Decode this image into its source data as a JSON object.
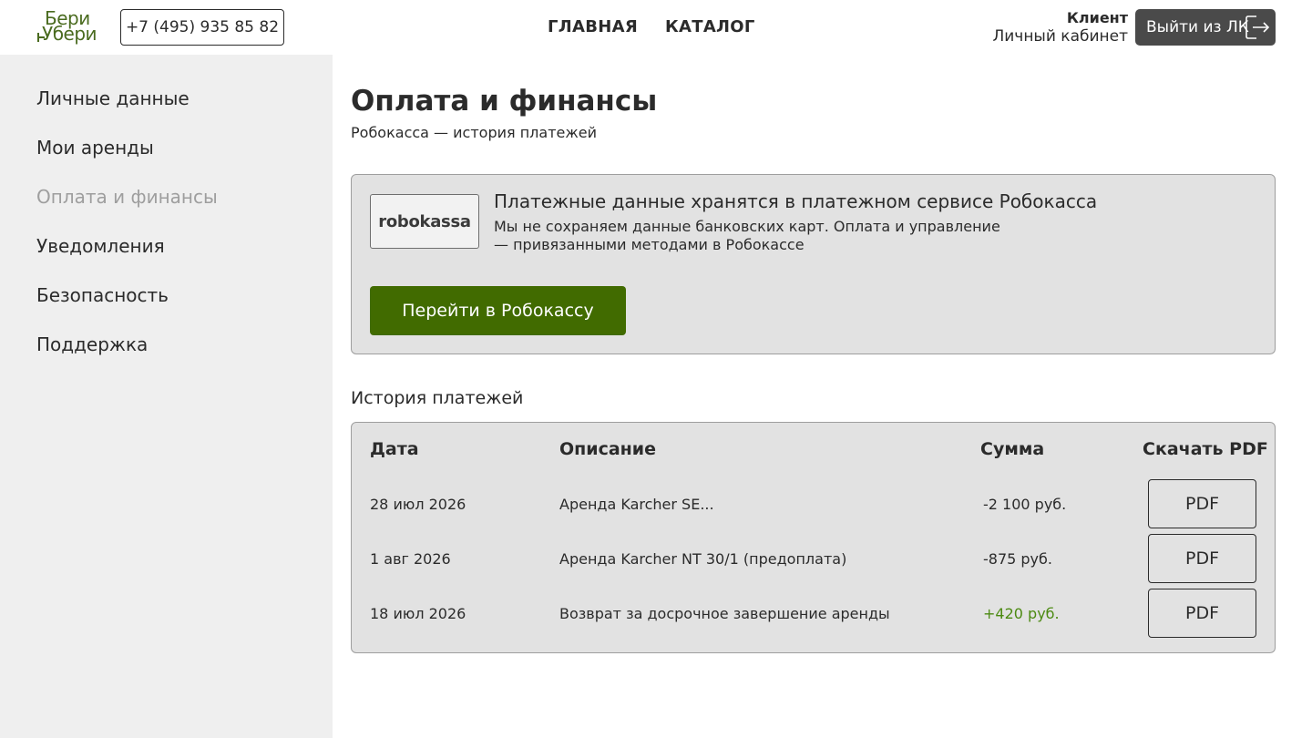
{
  "header": {
    "logo_line1": "Бери",
    "logo_line2": "Убери",
    "phone": "+7 (495) 935 85 82",
    "nav": [
      {
        "label": "ГЛАВНАЯ"
      },
      {
        "label": "КАТАЛОГ"
      }
    ],
    "user_role": "Клиент",
    "user_area": "Личный кабинет",
    "logout_label": "Выйти из ЛК",
    "logout_icon": "logout-icon"
  },
  "sidebar": {
    "items": [
      {
        "label": "Личные данные",
        "active": false
      },
      {
        "label": "Мои аренды",
        "active": false
      },
      {
        "label": "Оплата и финансы",
        "active": true
      },
      {
        "label": "Уведомления",
        "active": false
      },
      {
        "label": "Безопасность",
        "active": false
      },
      {
        "label": "Поддержка",
        "active": false
      }
    ]
  },
  "main": {
    "title": "Оплата и финансы",
    "subtitle": "Робокасса — история платежей",
    "robokassa": {
      "logo_text": "robokassa",
      "title": "Платежные данные хранятся в платежном сервисе Робокасса",
      "description": "Мы не сохраняем данные банковских карт. Оплата и управление — привязанными методами в Робокассе",
      "button_label": "Перейти в Робокассу"
    },
    "history": {
      "title": "История платежей",
      "columns": {
        "date": "Дата",
        "description": "Описание",
        "amount": "Сумма",
        "pdf": "Скачать PDF"
      },
      "rows": [
        {
          "date": "28 июл 2026",
          "description": "Аренда Karcher SE...",
          "amount": "-2 100 руб.",
          "pdf_label": "PDF"
        },
        {
          "date": "1 авг 2026",
          "description": "Аренда Karcher NT 30/1 (предоплата)",
          "amount": "-875 руб.",
          "pdf_label": "PDF"
        },
        {
          "date": "18 июл 2026",
          "description": "Возврат за досрочное завершение аренды",
          "amount": "+420 руб.",
          "pdf_label": "PDF"
        }
      ]
    }
  },
  "colors": {
    "brand_green": "#416b00",
    "positive_amount": "#4c8a12",
    "sidebar_bg": "#efefef",
    "card_bg": "#e2e2e2",
    "active_item": "#9e9e9e"
  }
}
